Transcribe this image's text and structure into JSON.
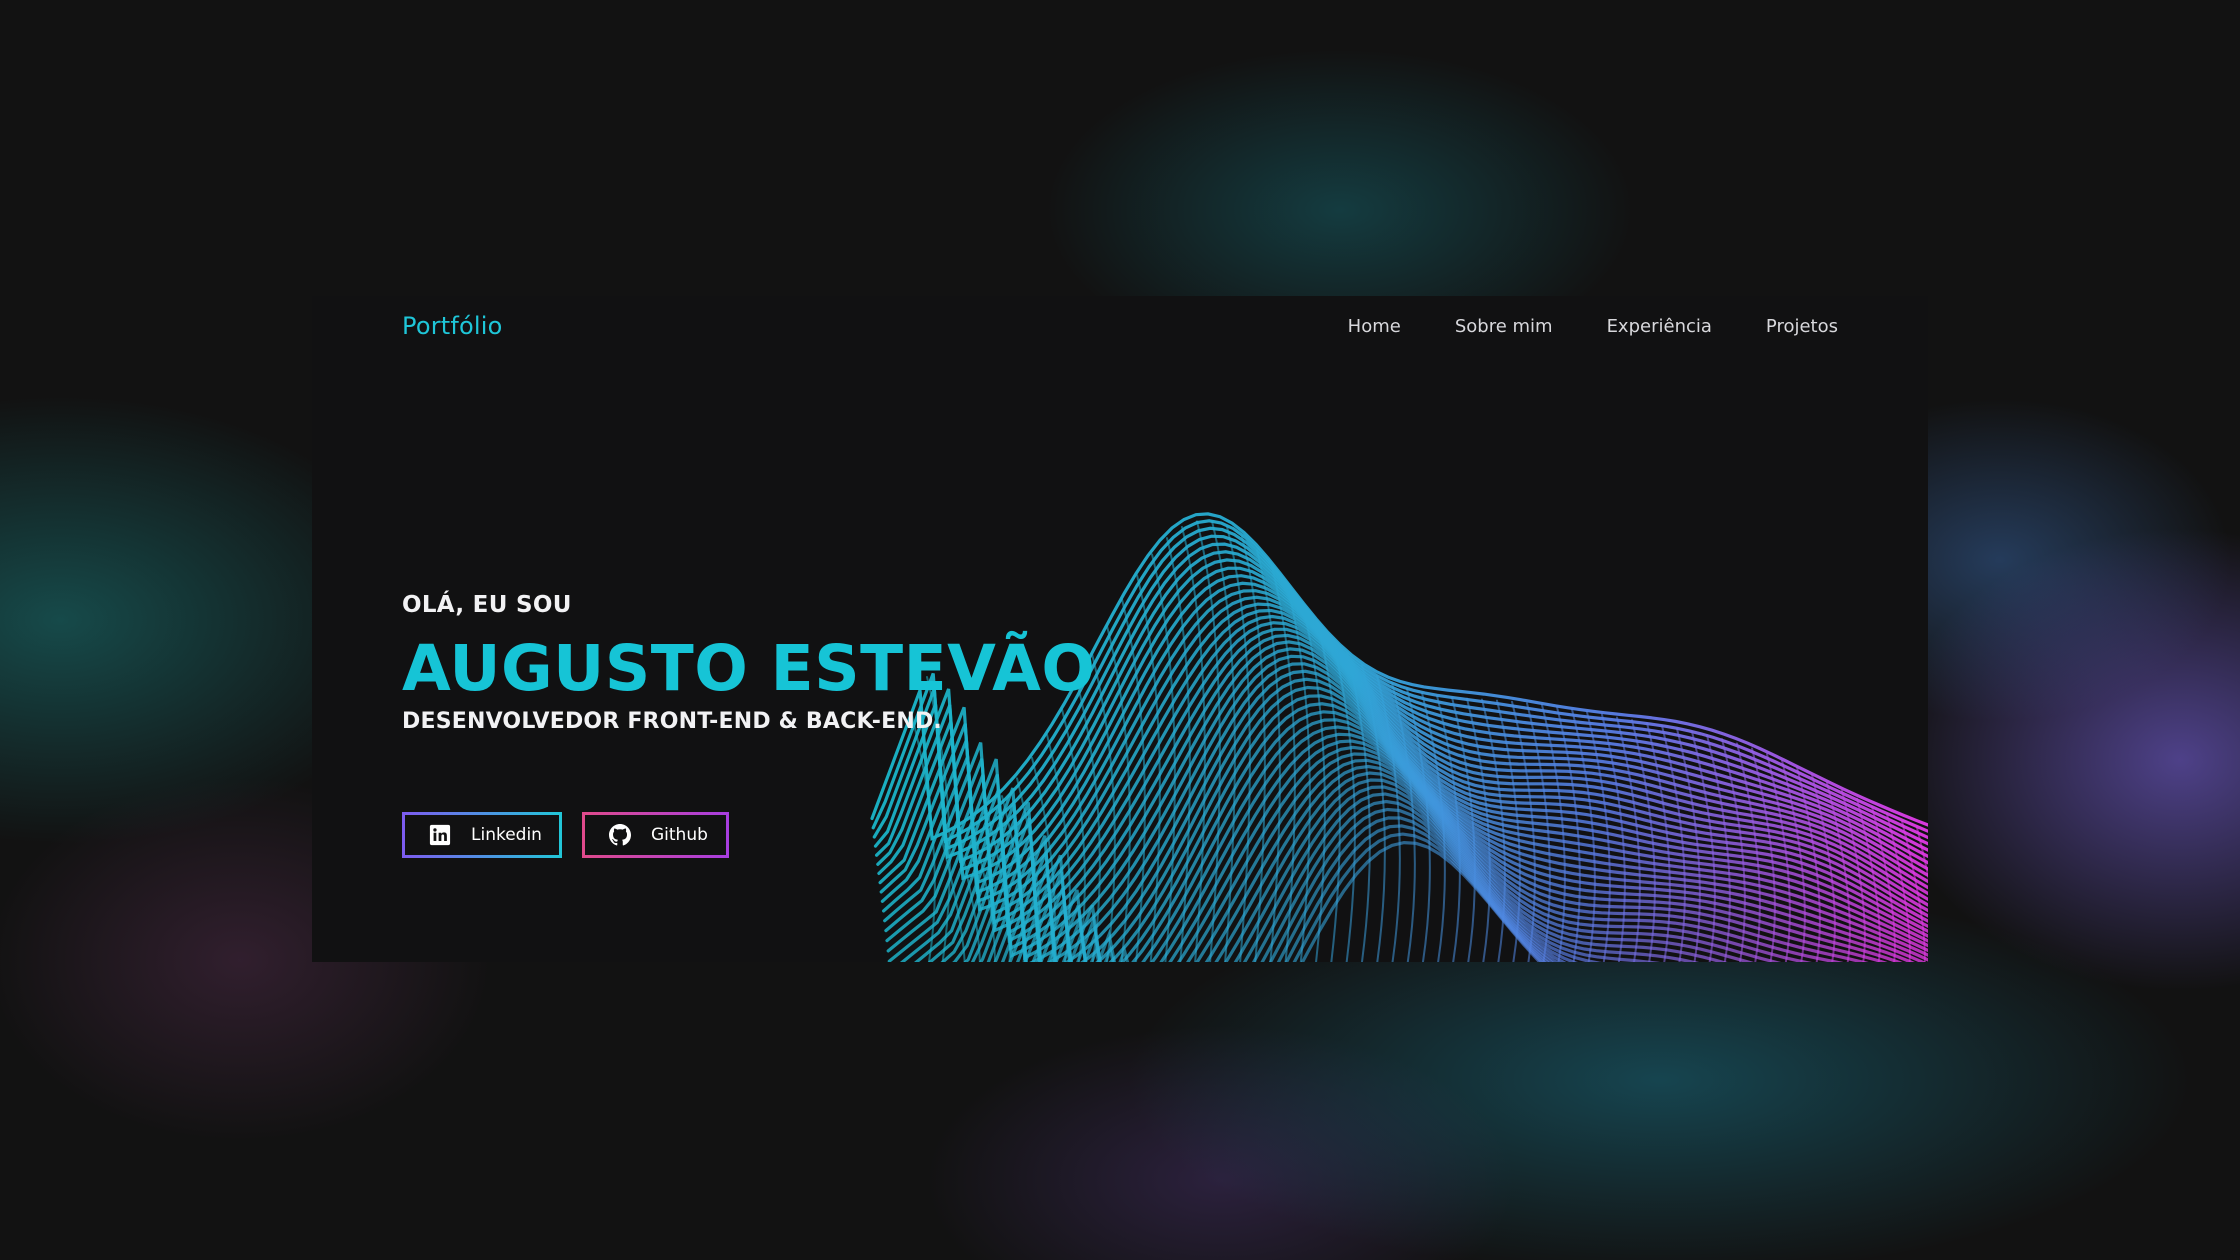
{
  "header": {
    "brand": "Portfólio",
    "nav": [
      {
        "label": "Home"
      },
      {
        "label": "Sobre mim"
      },
      {
        "label": "Experiência"
      },
      {
        "label": "Projetos"
      }
    ]
  },
  "hero": {
    "greeting": "OLÁ, EU SOU",
    "name": "AUGUSTO ESTEVÃO",
    "role": "DESENVOLVEDOR FRONT-END & BACK-END."
  },
  "buttons": {
    "linkedin": {
      "label": "Linkedin",
      "icon": "linkedin-icon"
    },
    "github": {
      "label": "Github",
      "icon": "github-icon"
    }
  },
  "colors": {
    "accent": "#16c4d6",
    "wave_start": "#1fc6d8",
    "wave_mid": "#4a86e8",
    "wave_end": "#e03ae8",
    "background": "#111112"
  }
}
